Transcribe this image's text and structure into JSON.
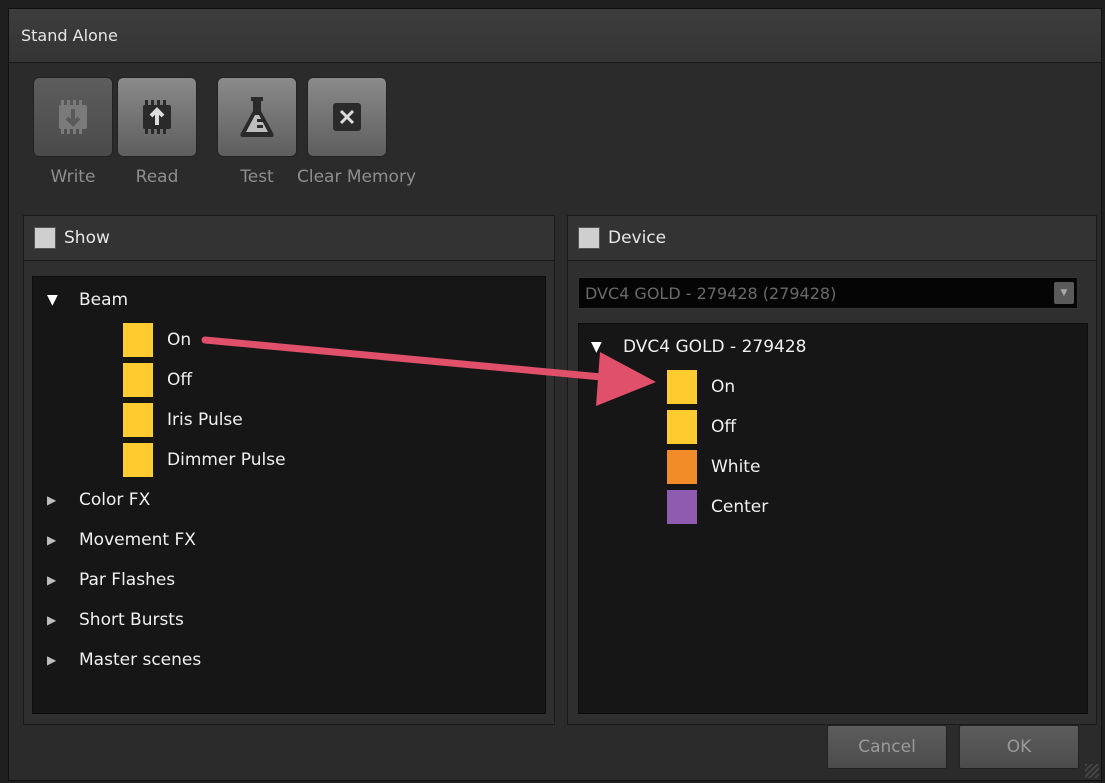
{
  "window": {
    "title": "Stand Alone"
  },
  "toolbar": {
    "write": {
      "label": "Write",
      "icon": "chip-download-icon",
      "enabled": false
    },
    "read": {
      "label": "Read",
      "icon": "chip-upload-icon",
      "enabled": true
    },
    "test": {
      "label": "Test",
      "icon": "flask-icon",
      "enabled": true
    },
    "clear": {
      "label": "Clear Memory",
      "icon": "clear-x-icon",
      "enabled": true
    }
  },
  "show_panel": {
    "title": "Show",
    "tree": {
      "beam": {
        "label": "Beam",
        "expanded": true,
        "children": [
          {
            "label": "On",
            "color": "#ffcb2f"
          },
          {
            "label": "Off",
            "color": "#ffcb2f"
          },
          {
            "label": "Iris Pulse",
            "color": "#ffcb2f"
          },
          {
            "label": "Dimmer Pulse",
            "color": "#ffcb2f"
          }
        ]
      },
      "collapsed": [
        "Color FX",
        "Movement FX",
        "Par Flashes",
        "Short Bursts",
        "Master scenes"
      ]
    }
  },
  "device_panel": {
    "title": "Device",
    "selector": {
      "value": "DVC4 GOLD - 279428 (279428)"
    },
    "tree": {
      "device": {
        "label": "DVC4 GOLD - 279428",
        "expanded": true,
        "children": [
          {
            "label": "On",
            "color": "#ffcb2f"
          },
          {
            "label": "Off",
            "color": "#ffcb2f"
          },
          {
            "label": "White",
            "color": "#f28c28"
          },
          {
            "label": "Center",
            "color": "#8e5bb0"
          }
        ]
      }
    }
  },
  "footer": {
    "cancel": "Cancel",
    "ok": "OK"
  },
  "annotation": {
    "arrow_color": "#e0506a"
  }
}
